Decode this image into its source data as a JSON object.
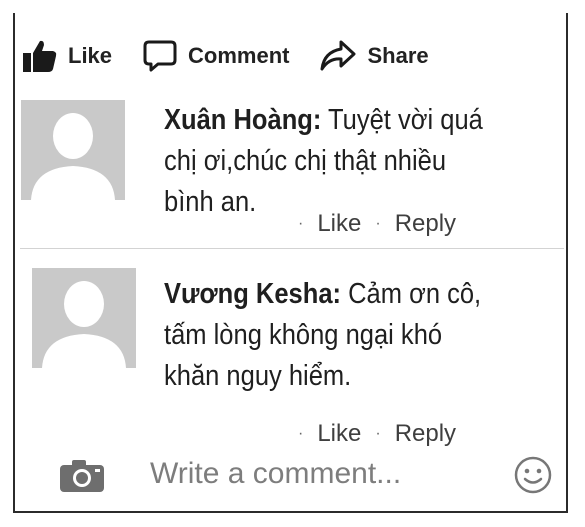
{
  "actions": {
    "like": "Like",
    "comment": "Comment",
    "share": "Share"
  },
  "comments": [
    {
      "name": "Xuân Hoàng:",
      "lines": [
        "Tuyệt vời quá",
        "chị ơi,chúc chị thật nhiều",
        "bình an."
      ],
      "like": "Like",
      "reply": "Reply"
    },
    {
      "name": "Vương Kesha:",
      "lines": [
        "Cảm ơn cô,",
        "tấm lòng không ngại khó",
        "khăn nguy hiểm."
      ],
      "like": "Like",
      "reply": "Reply"
    }
  ],
  "composer": {
    "placeholder": "Write a comment..."
  },
  "icons": {
    "like": "thumbs-up-icon",
    "comment": "speech-bubble-icon",
    "share": "share-arrow-icon",
    "camera": "camera-icon",
    "emoji": "smiley-icon"
  }
}
